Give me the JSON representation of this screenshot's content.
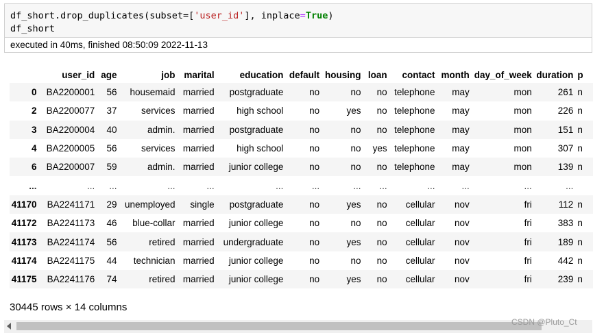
{
  "code_cell": {
    "line1_prefix": "df_short.drop_duplicates(subset=[",
    "line1_string": "'user_id'",
    "line1_mid": "], ",
    "line1_kwarg": "inplace",
    "line1_eq": "=",
    "line1_true": "True",
    "line1_close": ")",
    "line2": "df_short"
  },
  "execution_info": "executed in 40ms, finished 08:50:09 2022-11-13",
  "table": {
    "columns": [
      "user_id",
      "age",
      "job",
      "marital",
      "education",
      "default",
      "housing",
      "loan",
      "contact",
      "month",
      "day_of_week",
      "duration",
      "p"
    ],
    "rows": [
      {
        "index": "0",
        "cells": [
          "BA2200001",
          "56",
          "housemaid",
          "married",
          "postgraduate",
          "no",
          "no",
          "no",
          "telephone",
          "may",
          "mon",
          "261",
          "n"
        ]
      },
      {
        "index": "2",
        "cells": [
          "BA2200077",
          "37",
          "services",
          "married",
          "high school",
          "no",
          "yes",
          "no",
          "telephone",
          "may",
          "mon",
          "226",
          "n"
        ]
      },
      {
        "index": "3",
        "cells": [
          "BA2200004",
          "40",
          "admin.",
          "married",
          "postgraduate",
          "no",
          "no",
          "no",
          "telephone",
          "may",
          "mon",
          "151",
          "n"
        ]
      },
      {
        "index": "4",
        "cells": [
          "BA2200005",
          "56",
          "services",
          "married",
          "high school",
          "no",
          "no",
          "yes",
          "telephone",
          "may",
          "mon",
          "307",
          "n"
        ]
      },
      {
        "index": "6",
        "cells": [
          "BA2200007",
          "59",
          "admin.",
          "married",
          "junior college",
          "no",
          "no",
          "no",
          "telephone",
          "may",
          "mon",
          "139",
          "n"
        ]
      },
      {
        "index": "...",
        "cells": [
          "...",
          "...",
          "...",
          "...",
          "...",
          "...",
          "...",
          "...",
          "...",
          "...",
          "...",
          "...",
          ""
        ]
      },
      {
        "index": "41170",
        "cells": [
          "BA2241171",
          "29",
          "unemployed",
          "single",
          "postgraduate",
          "no",
          "yes",
          "no",
          "cellular",
          "nov",
          "fri",
          "112",
          "n"
        ]
      },
      {
        "index": "41172",
        "cells": [
          "BA2241173",
          "46",
          "blue-collar",
          "married",
          "junior college",
          "no",
          "no",
          "no",
          "cellular",
          "nov",
          "fri",
          "383",
          "n"
        ]
      },
      {
        "index": "41173",
        "cells": [
          "BA2241174",
          "56",
          "retired",
          "married",
          "undergraduate",
          "no",
          "yes",
          "no",
          "cellular",
          "nov",
          "fri",
          "189",
          "n"
        ]
      },
      {
        "index": "41174",
        "cells": [
          "BA2241175",
          "44",
          "technician",
          "married",
          "junior college",
          "no",
          "no",
          "no",
          "cellular",
          "nov",
          "fri",
          "442",
          "n"
        ]
      },
      {
        "index": "41175",
        "cells": [
          "BA2241176",
          "74",
          "retired",
          "married",
          "junior college",
          "no",
          "yes",
          "no",
          "cellular",
          "nov",
          "fri",
          "239",
          "n"
        ]
      }
    ]
  },
  "shape_text": "30445 rows × 14 columns",
  "watermark": "CSDN @Pluto_Ct"
}
